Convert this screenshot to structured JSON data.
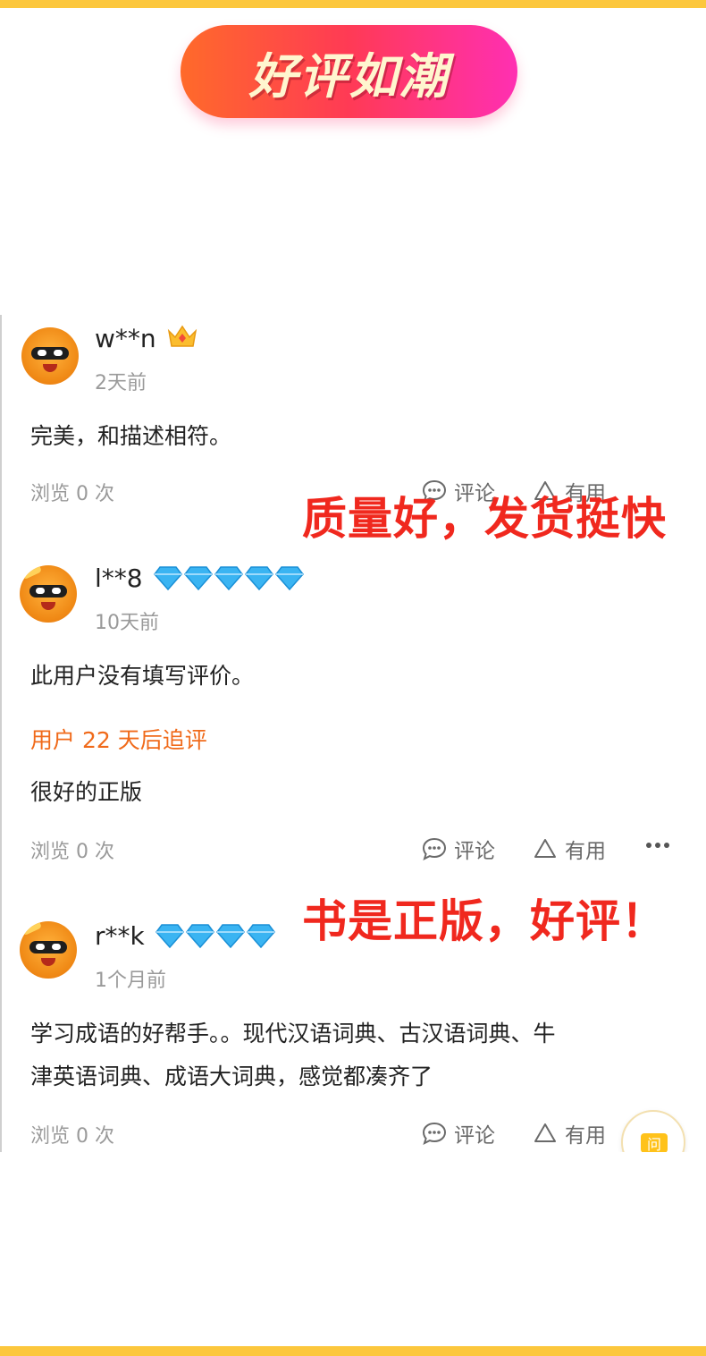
{
  "banner": {
    "title": "好评如潮"
  },
  "reviews": [
    {
      "username": "w**n",
      "time": "2天前",
      "content": "完美，和描述相符。",
      "views": "浏览 0 次",
      "comment_label": "评论",
      "useful_label": "有用",
      "badge": "crown-icon"
    },
    {
      "username": "l**8",
      "time": "10天前",
      "content": "此用户没有填写评价。",
      "followup_label": "用户 22 天后追评",
      "followup_content": "很好的正版",
      "views": "浏览 0 次",
      "comment_label": "评论",
      "useful_label": "有用",
      "badge": "diamond-icon",
      "badge_count": 5
    },
    {
      "username": "r**k",
      "time": "1个月前",
      "content_line1": "学习成语的好帮手。。现代汉语词典、古汉语词典、牛",
      "content_line2": "津英语词典、成语大词典，感觉都凑齐了",
      "views": "浏览 0 次",
      "comment_label": "评论",
      "useful_label": "有用",
      "badge": "diamond-icon",
      "badge_count": 4
    }
  ],
  "overlays": {
    "first": "质量好，发货挺快",
    "second": "书是正版，好评！"
  },
  "float_button": {
    "label": "问"
  },
  "colors": {
    "accent_bar": "#fcc73d",
    "overlay_text": "#f0281e",
    "followup_text": "#f06a1a",
    "banner_gradient": [
      "#ff6a2a",
      "#ff3a55",
      "#ff2fb2"
    ]
  }
}
